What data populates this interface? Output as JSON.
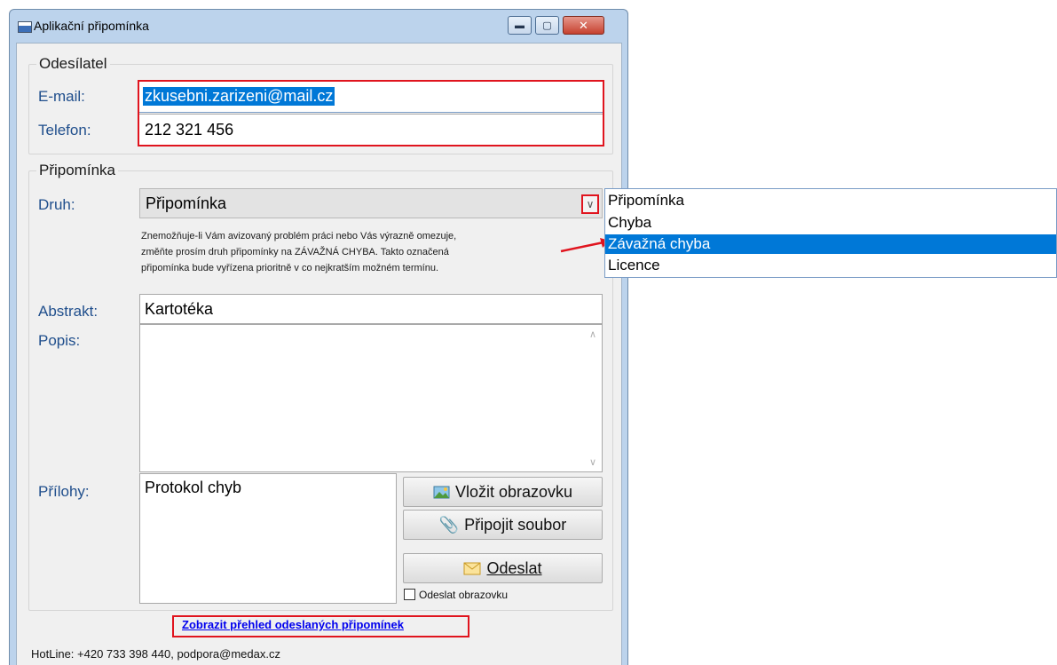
{
  "window": {
    "title": "Aplikační připomínka"
  },
  "sender": {
    "group_title": "Odesílatel",
    "email_label": "E-mail:",
    "email_value": "zkusebni.zarizeni@mail.cz",
    "phone_label": "Telefon:",
    "phone_value": "212 321 456"
  },
  "reminder": {
    "group_title": "Připomínka",
    "type_label": "Druh:",
    "type_value": "Připomínka",
    "hint_line1": "Znemožňuje-li Vám avizovaný problém práci nebo Vás výrazně omezuje,",
    "hint_line2": "změňte prosím druh připomínky na ZÁVAŽNÁ CHYBA. Takto označená",
    "hint_line3": "připomínka bude vyřízena prioritně v co nejkratším možném termínu.",
    "type_options": [
      "Připomínka",
      "Chyba",
      "Závažná chyba",
      "Licence"
    ],
    "abstract_label": "Abstrakt:",
    "abstract_value": "Kartotéka",
    "description_label": "Popis:",
    "description_value": "",
    "attachments_label": "Přílohy:",
    "attachments": [
      "Protokol chyb"
    ]
  },
  "buttons": {
    "insert_screen": "Vložit obrazovku",
    "attach_file": "Připojit soubor",
    "send": "Odeslat",
    "send_screen_checkbox": "Odeslat obrazovku"
  },
  "footer": {
    "history_link": "Zobrazit přehled odeslaných připomínek",
    "hotline": "HotLine: +420 733 398 440, podpora@medax.cz"
  },
  "colors": {
    "accent": "#0078d7",
    "highlight": "#e0141e",
    "label": "#1f4e8c"
  }
}
